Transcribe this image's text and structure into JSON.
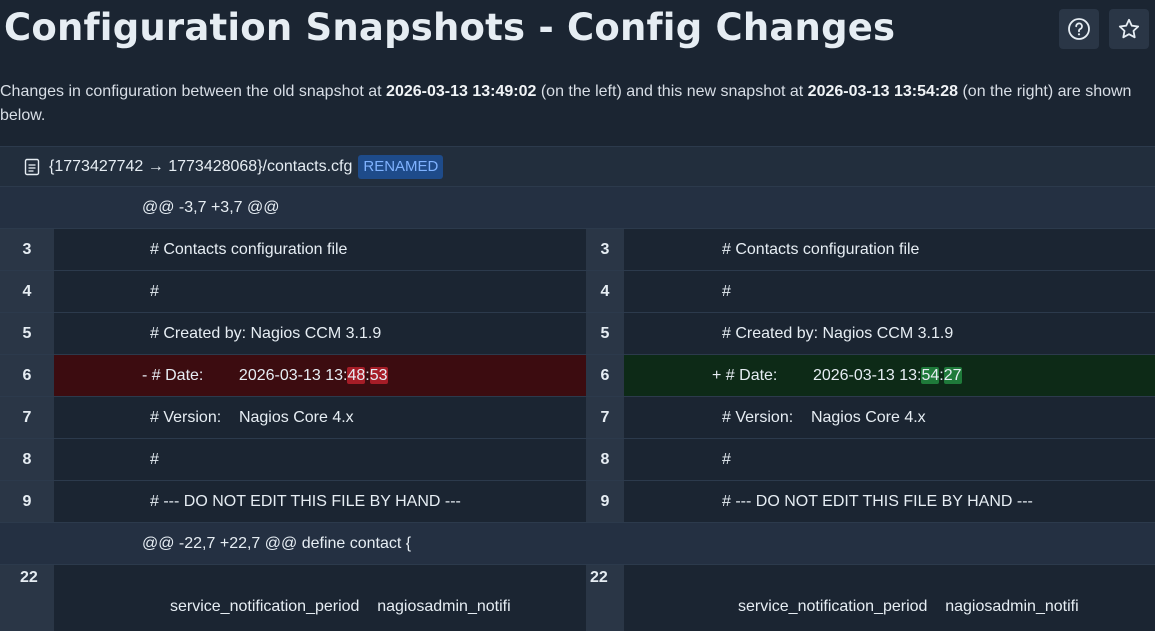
{
  "header": {
    "title": "Configuration Snapshots - Config Changes",
    "help_icon": "help-circle-icon",
    "star_icon": "star-outline-icon"
  },
  "description": {
    "prefix": "Changes in configuration between the old snapshot at ",
    "old_ts": "2026-03-13 13:49:02",
    "middle": " (on the left) and this new snapshot at ",
    "new_ts": "2026-03-13 13:54:28",
    "suffix": " (on the right) are shown below."
  },
  "file": {
    "icon": "file-text-icon",
    "path": "{1773427742 → 1773428068}/contacts.cfg",
    "status": "RENAMED"
  },
  "diff": {
    "hunk1": "@@ -3,7 +3,7 @@",
    "hunk2": "@@ -22,7 +22,7 @@ define contact {",
    "rows": [
      {
        "l": "3",
        "lt": "# Contacts configuration file",
        "r": "3",
        "rt": "# Contacts configuration file"
      },
      {
        "l": "4",
        "lt": "#",
        "r": "4",
        "rt": "#"
      },
      {
        "l": "5",
        "lt": "# Created by: Nagios CCM 3.1.9",
        "r": "5",
        "rt": "# Created by: Nagios CCM 3.1.9"
      },
      {
        "l": "7",
        "lt": "# Version:    Nagios Core 4.x",
        "r": "7",
        "rt": "# Version:    Nagios Core 4.x"
      },
      {
        "l": "8",
        "lt": "#",
        "r": "8",
        "rt": "#"
      },
      {
        "l": "9",
        "lt": "# --- DO NOT EDIT THIS FILE BY HAND ---",
        "r": "9",
        "rt": "# --- DO NOT EDIT THIS FILE BY HAND ---"
      }
    ],
    "changed": {
      "l": "6",
      "l_prefix": "- # Date:        2026-03-13 13:",
      "l_h1": "48",
      "l_mid": ":",
      "l_h2": "53",
      "r": "6",
      "r_prefix": "+ # Date:        2026-03-13 13:",
      "r_h1": "54",
      "r_mid": ":",
      "r_h2": "27"
    },
    "last": {
      "l": "22",
      "lt": "service_notification_period    nagiosadmin_notifi",
      "r": "22",
      "rt": "service_notification_period    nagiosadmin_notifi"
    }
  }
}
